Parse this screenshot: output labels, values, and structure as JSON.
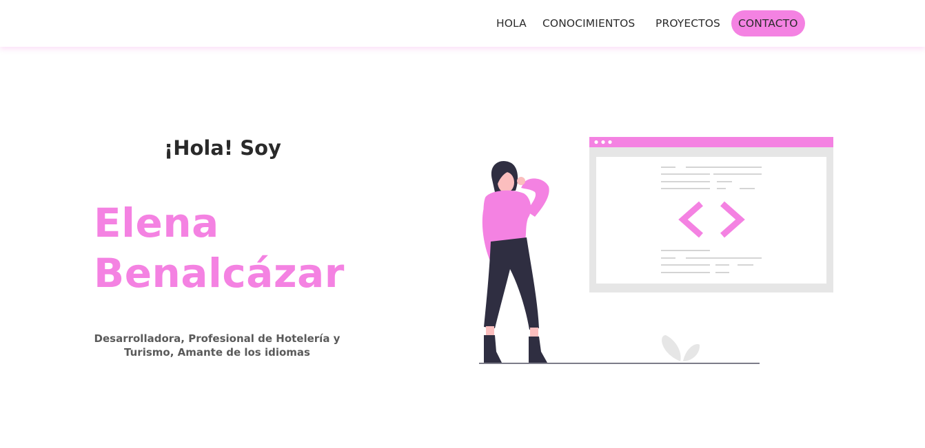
{
  "nav": {
    "items": [
      {
        "label": "HOLA"
      },
      {
        "label": "CONOCIMIENTOS"
      },
      {
        "label": "PROYECTOS"
      },
      {
        "label": "CONTACTO"
      }
    ]
  },
  "hero": {
    "greeting": "¡Hola! Soy",
    "name_first": "Elena",
    "name_last": "Benalcázar",
    "tagline": "Desarrolladora, Profesional de Hotelería y Turismo, Amante de los idiomas"
  },
  "theme": {
    "accent": "#f482e2",
    "dark": "#2f2e41",
    "light_gray": "#e6e6e6"
  }
}
